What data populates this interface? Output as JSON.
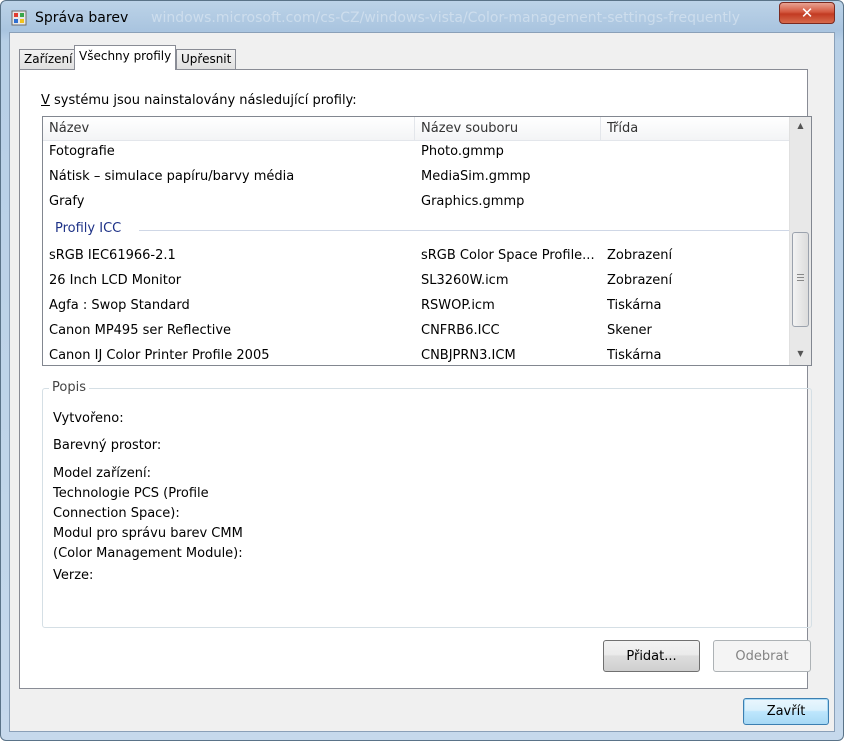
{
  "window": {
    "title": "Správa barev",
    "title_ghost": "windows.microsoft.com/cs-CZ/windows-vista/Color-management-settings-frequently",
    "close_glyph": "✕"
  },
  "tabs": [
    {
      "label": "Zařízení"
    },
    {
      "label": "Všechny profily"
    },
    {
      "label": "Upřesnit"
    }
  ],
  "profiles_section": {
    "label_prefix": "V",
    "label_rest": " systému jsou nainstalovány následující profily:"
  },
  "list": {
    "columns": [
      "Název",
      "Název souboru",
      "Třída"
    ],
    "rows_top": [
      {
        "name": "Fotografie",
        "file": "Photo.gmmp",
        "class": ""
      },
      {
        "name": "Nátisk – simulace papíru/barvy média",
        "file": "MediaSim.gmmp",
        "class": ""
      },
      {
        "name": "Grafy",
        "file": "Graphics.gmmp",
        "class": ""
      }
    ],
    "group_label": "Profily ICC",
    "rows_icc": [
      {
        "name": "sRGB IEC61966-2.1",
        "file": "sRGB Color Space Profile...",
        "class": "Zobrazení"
      },
      {
        "name": "26 Inch LCD Monitor",
        "file": "SL3260W.icm",
        "class": "Zobrazení"
      },
      {
        "name": "Agfa : Swop Standard",
        "file": "RSWOP.icm",
        "class": "Tiskárna"
      },
      {
        "name": "Canon MP495 ser Reflective",
        "file": "CNFRB6.ICC",
        "class": "Skener"
      },
      {
        "name": "Canon IJ Color Printer Profile 2005",
        "file": "CNBJPRN3.ICM",
        "class": "Tiskárna"
      }
    ]
  },
  "description": {
    "title": "Popis",
    "created": "Vytvořeno:",
    "color_space": "Barevný prostor:",
    "device_model": "Model zařízení:",
    "pcs_line1": "Technologie PCS (Profile",
    "pcs_line2": "Connection Space):",
    "cmm_line1": "Modul pro správu barev CMM",
    "cmm_line2": "(Color Management Module):",
    "version": "Verze:"
  },
  "buttons": {
    "add": "Přidat...",
    "remove": "Odebrat",
    "close": "Zavřít"
  },
  "icons": {
    "app": "color-management-icon",
    "scroll_up": "▲",
    "scroll_down": "▼"
  }
}
